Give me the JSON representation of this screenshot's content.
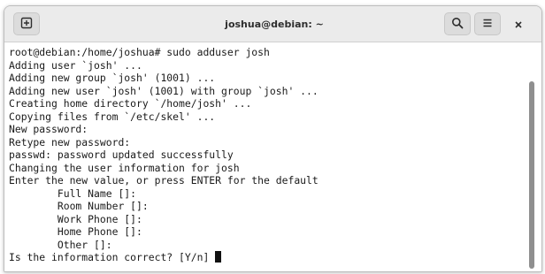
{
  "window": {
    "title": "joshua@debian: ~"
  },
  "header": {
    "new_tab_icon": "new-tab-icon",
    "search_icon": "search-icon",
    "menu_icon": "hamburger-menu-icon",
    "close_icon": "close-icon"
  },
  "terminal": {
    "lines": [
      "root@debian:/home/joshua# sudo adduser josh",
      "Adding user `josh' ...",
      "Adding new group `josh' (1001) ...",
      "Adding new user `josh' (1001) with group `josh' ...",
      "Creating home directory `/home/josh' ...",
      "Copying files from `/etc/skel' ...",
      "New password:",
      "Retype new password:",
      "passwd: password updated successfully",
      "Changing the user information for josh",
      "Enter the new value, or press ENTER for the default",
      "        Full Name []:",
      "        Room Number []:",
      "        Work Phone []:",
      "        Home Phone []:",
      "        Other []:",
      "Is the information correct? [Y/n] "
    ]
  },
  "colors": {
    "headerbar": "#ebebeb",
    "terminal_bg": "#ffffff",
    "text": "#1a1a1a",
    "scrollbar": "#8f8f8f"
  }
}
